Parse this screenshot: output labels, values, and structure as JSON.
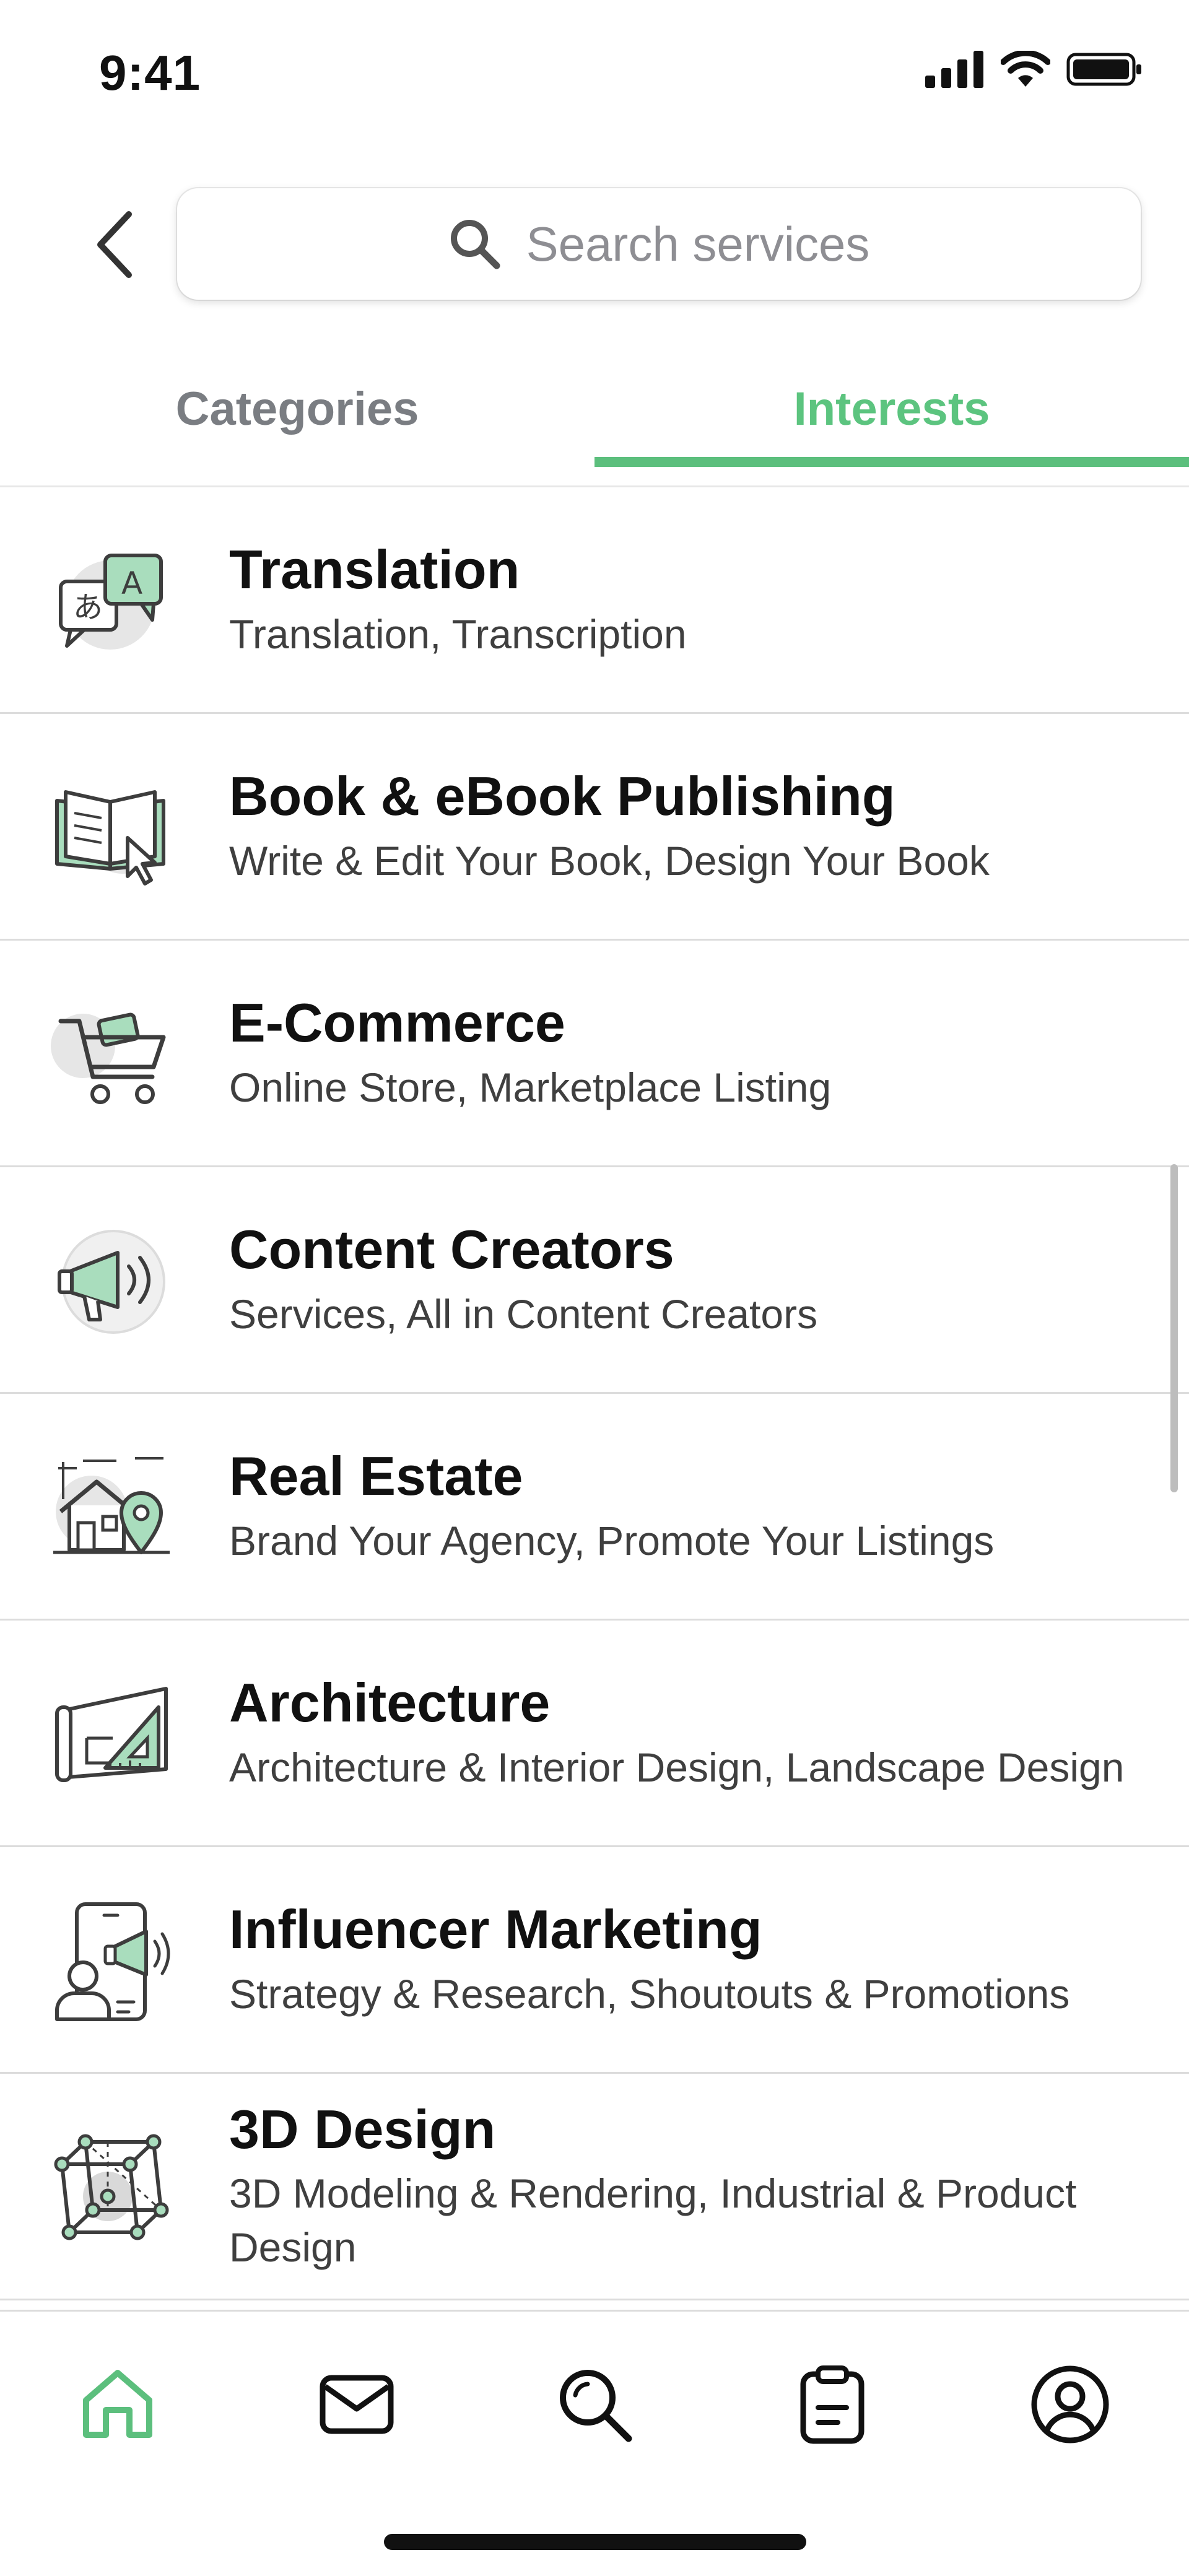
{
  "status_bar": {
    "time": "9:41"
  },
  "header": {
    "search_placeholder": "Search services"
  },
  "tabs": [
    {
      "label": "Categories",
      "active": false
    },
    {
      "label": "Interests",
      "active": true
    }
  ],
  "accent_color": "#5CBF7D",
  "list": [
    {
      "title": "Translation",
      "subtitle": "Translation, Transcription",
      "icon": "translation-icon"
    },
    {
      "title": "Book & eBook Publishing",
      "subtitle": "Write & Edit Your Book, Design Your Book",
      "icon": "book-icon"
    },
    {
      "title": "E-Commerce",
      "subtitle": "Online Store, Marketplace Listing",
      "icon": "cart-icon"
    },
    {
      "title": "Content Creators",
      "subtitle": "Services, All in Content Creators",
      "icon": "megaphone-icon"
    },
    {
      "title": "Real Estate",
      "subtitle": "Brand Your Agency, Promote Your Listings",
      "icon": "house-icon"
    },
    {
      "title": "Architecture",
      "subtitle": "Architecture & Interior Design, Landscape Design",
      "icon": "blueprint-icon"
    },
    {
      "title": "Influencer Marketing",
      "subtitle": "Strategy & Research, Shoutouts & Promotions",
      "icon": "influencer-icon"
    },
    {
      "title": "3D Design",
      "subtitle": "3D Modeling & Rendering, Industrial & Product Design",
      "icon": "cube-icon"
    }
  ],
  "bottom_nav": [
    {
      "name": "home",
      "icon": "home-icon",
      "active": true
    },
    {
      "name": "messages",
      "icon": "mail-icon",
      "active": false
    },
    {
      "name": "search",
      "icon": "search-icon",
      "active": false
    },
    {
      "name": "orders",
      "icon": "clipboard-icon",
      "active": false
    },
    {
      "name": "profile",
      "icon": "profile-icon",
      "active": false
    }
  ]
}
